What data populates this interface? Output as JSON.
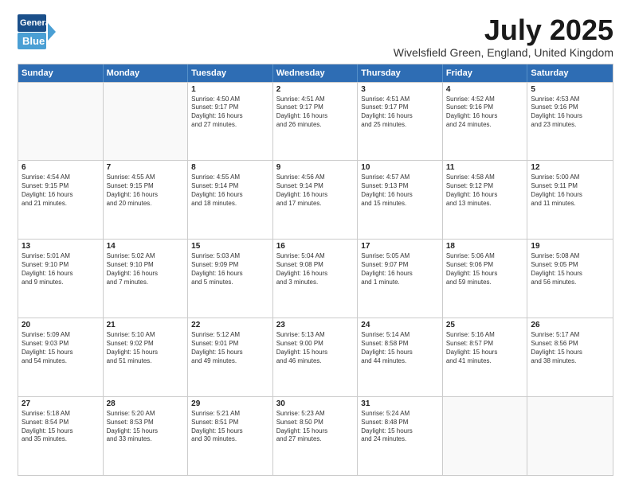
{
  "logo": {
    "line1": "General",
    "line2": "Blue"
  },
  "title": "July 2025",
  "location": "Wivelsfield Green, England, United Kingdom",
  "days": [
    "Sunday",
    "Monday",
    "Tuesday",
    "Wednesday",
    "Thursday",
    "Friday",
    "Saturday"
  ],
  "weeks": [
    [
      {
        "day": "",
        "info": ""
      },
      {
        "day": "",
        "info": ""
      },
      {
        "day": "1",
        "info": "Sunrise: 4:50 AM\nSunset: 9:17 PM\nDaylight: 16 hours\nand 27 minutes."
      },
      {
        "day": "2",
        "info": "Sunrise: 4:51 AM\nSunset: 9:17 PM\nDaylight: 16 hours\nand 26 minutes."
      },
      {
        "day": "3",
        "info": "Sunrise: 4:51 AM\nSunset: 9:17 PM\nDaylight: 16 hours\nand 25 minutes."
      },
      {
        "day": "4",
        "info": "Sunrise: 4:52 AM\nSunset: 9:16 PM\nDaylight: 16 hours\nand 24 minutes."
      },
      {
        "day": "5",
        "info": "Sunrise: 4:53 AM\nSunset: 9:16 PM\nDaylight: 16 hours\nand 23 minutes."
      }
    ],
    [
      {
        "day": "6",
        "info": "Sunrise: 4:54 AM\nSunset: 9:15 PM\nDaylight: 16 hours\nand 21 minutes."
      },
      {
        "day": "7",
        "info": "Sunrise: 4:55 AM\nSunset: 9:15 PM\nDaylight: 16 hours\nand 20 minutes."
      },
      {
        "day": "8",
        "info": "Sunrise: 4:55 AM\nSunset: 9:14 PM\nDaylight: 16 hours\nand 18 minutes."
      },
      {
        "day": "9",
        "info": "Sunrise: 4:56 AM\nSunset: 9:14 PM\nDaylight: 16 hours\nand 17 minutes."
      },
      {
        "day": "10",
        "info": "Sunrise: 4:57 AM\nSunset: 9:13 PM\nDaylight: 16 hours\nand 15 minutes."
      },
      {
        "day": "11",
        "info": "Sunrise: 4:58 AM\nSunset: 9:12 PM\nDaylight: 16 hours\nand 13 minutes."
      },
      {
        "day": "12",
        "info": "Sunrise: 5:00 AM\nSunset: 9:11 PM\nDaylight: 16 hours\nand 11 minutes."
      }
    ],
    [
      {
        "day": "13",
        "info": "Sunrise: 5:01 AM\nSunset: 9:10 PM\nDaylight: 16 hours\nand 9 minutes."
      },
      {
        "day": "14",
        "info": "Sunrise: 5:02 AM\nSunset: 9:10 PM\nDaylight: 16 hours\nand 7 minutes."
      },
      {
        "day": "15",
        "info": "Sunrise: 5:03 AM\nSunset: 9:09 PM\nDaylight: 16 hours\nand 5 minutes."
      },
      {
        "day": "16",
        "info": "Sunrise: 5:04 AM\nSunset: 9:08 PM\nDaylight: 16 hours\nand 3 minutes."
      },
      {
        "day": "17",
        "info": "Sunrise: 5:05 AM\nSunset: 9:07 PM\nDaylight: 16 hours\nand 1 minute."
      },
      {
        "day": "18",
        "info": "Sunrise: 5:06 AM\nSunset: 9:06 PM\nDaylight: 15 hours\nand 59 minutes."
      },
      {
        "day": "19",
        "info": "Sunrise: 5:08 AM\nSunset: 9:05 PM\nDaylight: 15 hours\nand 56 minutes."
      }
    ],
    [
      {
        "day": "20",
        "info": "Sunrise: 5:09 AM\nSunset: 9:03 PM\nDaylight: 15 hours\nand 54 minutes."
      },
      {
        "day": "21",
        "info": "Sunrise: 5:10 AM\nSunset: 9:02 PM\nDaylight: 15 hours\nand 51 minutes."
      },
      {
        "day": "22",
        "info": "Sunrise: 5:12 AM\nSunset: 9:01 PM\nDaylight: 15 hours\nand 49 minutes."
      },
      {
        "day": "23",
        "info": "Sunrise: 5:13 AM\nSunset: 9:00 PM\nDaylight: 15 hours\nand 46 minutes."
      },
      {
        "day": "24",
        "info": "Sunrise: 5:14 AM\nSunset: 8:58 PM\nDaylight: 15 hours\nand 44 minutes."
      },
      {
        "day": "25",
        "info": "Sunrise: 5:16 AM\nSunset: 8:57 PM\nDaylight: 15 hours\nand 41 minutes."
      },
      {
        "day": "26",
        "info": "Sunrise: 5:17 AM\nSunset: 8:56 PM\nDaylight: 15 hours\nand 38 minutes."
      }
    ],
    [
      {
        "day": "27",
        "info": "Sunrise: 5:18 AM\nSunset: 8:54 PM\nDaylight: 15 hours\nand 35 minutes."
      },
      {
        "day": "28",
        "info": "Sunrise: 5:20 AM\nSunset: 8:53 PM\nDaylight: 15 hours\nand 33 minutes."
      },
      {
        "day": "29",
        "info": "Sunrise: 5:21 AM\nSunset: 8:51 PM\nDaylight: 15 hours\nand 30 minutes."
      },
      {
        "day": "30",
        "info": "Sunrise: 5:23 AM\nSunset: 8:50 PM\nDaylight: 15 hours\nand 27 minutes."
      },
      {
        "day": "31",
        "info": "Sunrise: 5:24 AM\nSunset: 8:48 PM\nDaylight: 15 hours\nand 24 minutes."
      },
      {
        "day": "",
        "info": ""
      },
      {
        "day": "",
        "info": ""
      }
    ]
  ]
}
